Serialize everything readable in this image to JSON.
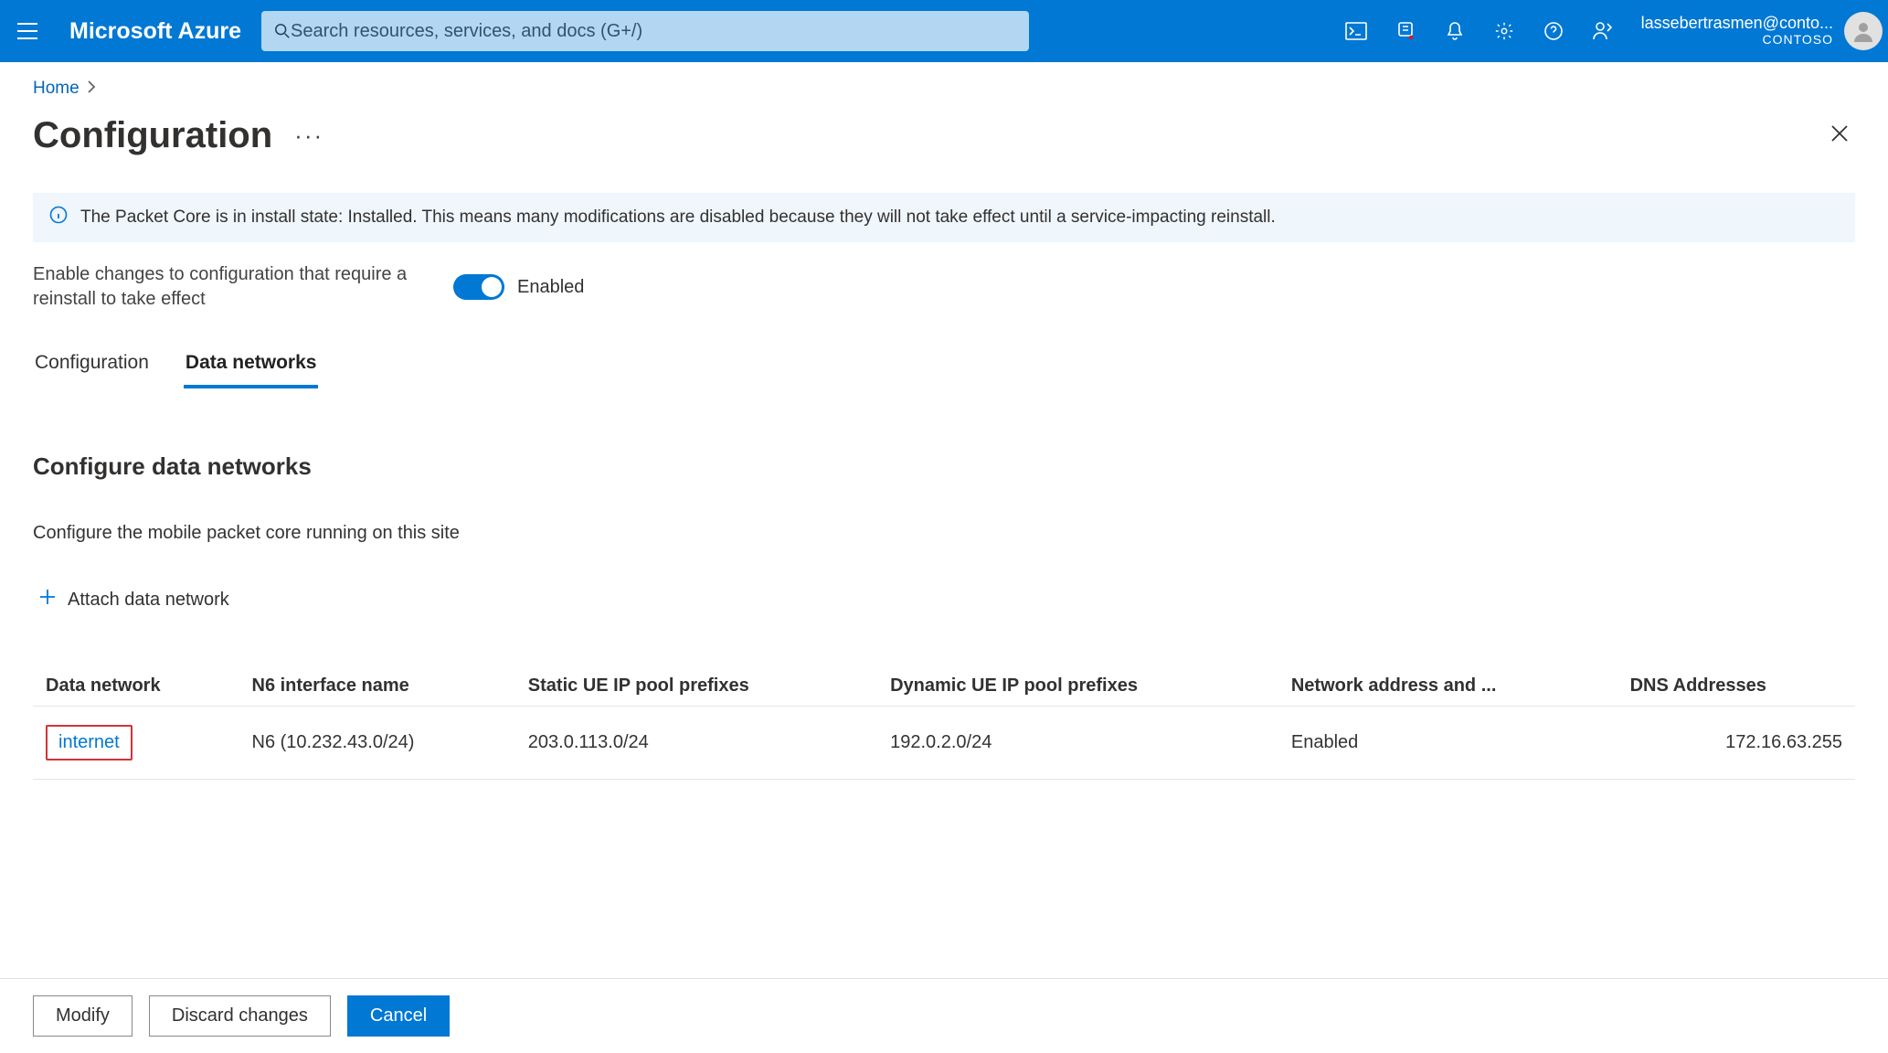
{
  "header": {
    "brand": "Microsoft Azure",
    "search_placeholder": "Search resources, services, and docs (G+/)",
    "account_email": "lassebertrasmen@conto...",
    "account_tenant": "CONTOSO"
  },
  "breadcrumb": {
    "home": "Home"
  },
  "page": {
    "title": "Configuration"
  },
  "banner": {
    "text": "The Packet Core is in install state: Installed. This means many modifications are disabled because they will not take effect until a service-impacting reinstall."
  },
  "toggle": {
    "label": "Enable changes to configuration that require a reinstall to take effect",
    "state_text": "Enabled"
  },
  "tabs": {
    "configuration": "Configuration",
    "data_networks": "Data networks"
  },
  "section": {
    "heading": "Configure data networks",
    "sub": "Configure the mobile packet core running on this site",
    "attach": "Attach data network"
  },
  "table": {
    "columns": {
      "data_network": "Data network",
      "n6": "N6 interface name",
      "static_ue": "Static UE IP pool prefixes",
      "dynamic_ue": "Dynamic UE IP pool prefixes",
      "napt": "Network address and ...",
      "dns": "DNS Addresses"
    },
    "rows": [
      {
        "name": "internet",
        "n6": "N6 (10.232.43.0/24)",
        "static_ue": "203.0.113.0/24",
        "dynamic_ue": "192.0.2.0/24",
        "napt": "Enabled",
        "dns": "172.16.63.255"
      }
    ]
  },
  "footer": {
    "modify": "Modify",
    "discard": "Discard changes",
    "cancel": "Cancel"
  }
}
